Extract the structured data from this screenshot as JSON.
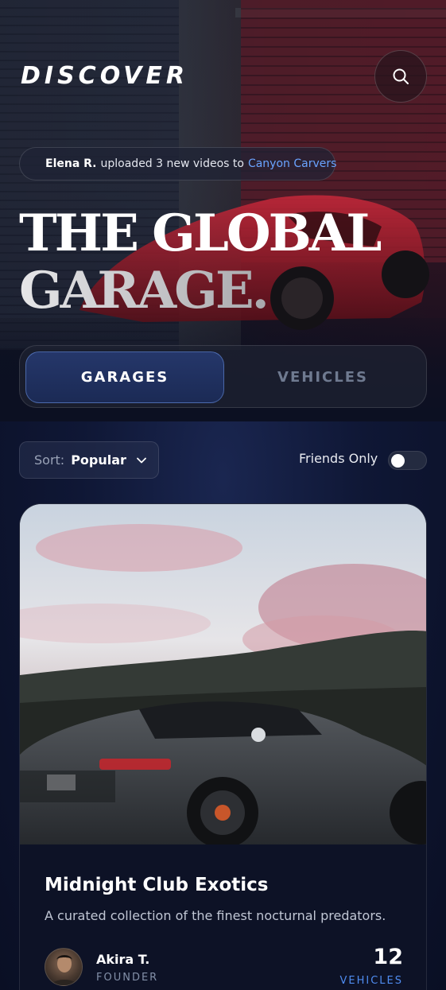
{
  "header": {
    "title": "DISCOVER",
    "search_icon": "search-icon"
  },
  "activity": {
    "user": "Elena R.",
    "text": "uploaded 3 new videos to",
    "garage": "Canyon Carvers"
  },
  "hero": {
    "line1": "THE GLOBAL",
    "line2": "GARAGE."
  },
  "tabs": [
    {
      "label": "GARAGES",
      "active": true
    },
    {
      "label": "VEHICLES",
      "active": false
    }
  ],
  "filters": {
    "sort_key": "Sort:",
    "sort_value": "Popular",
    "friends_only_label": "Friends Only",
    "friends_only": false
  },
  "card": {
    "title": "Midnight Club Exotics",
    "description": "A curated collection of the finest nocturnal predators.",
    "owner_name": "Akira T.",
    "owner_role": "FOUNDER",
    "vehicle_count": "12",
    "vehicle_label": "VEHICLES"
  },
  "colors": {
    "accent": "#4d8df0",
    "link": "#6aa3ff",
    "background": "#0b1024"
  }
}
